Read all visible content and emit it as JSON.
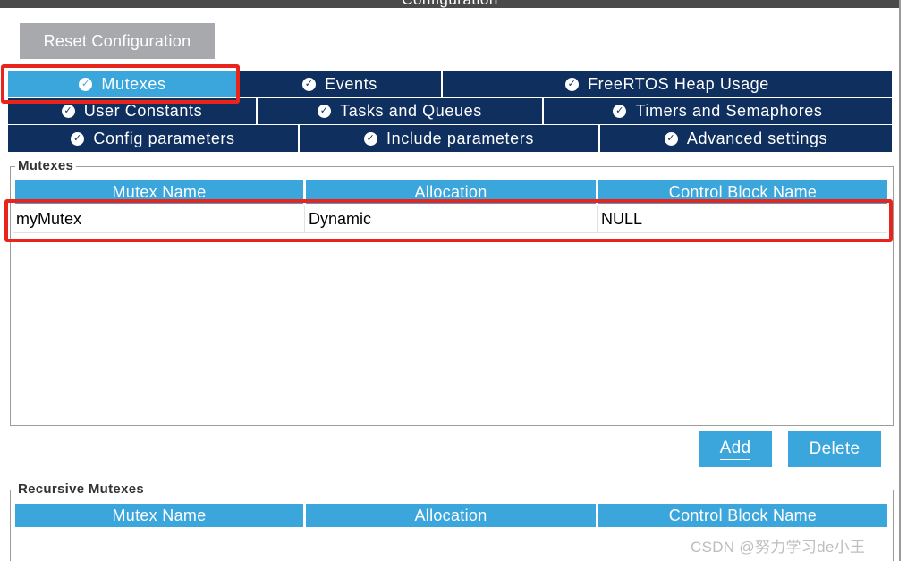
{
  "window": {
    "title": "Configuration"
  },
  "reset_button": {
    "label": "Reset Configuration"
  },
  "tabs": {
    "row1": [
      {
        "label": "Mutexes",
        "active": true
      },
      {
        "label": "Events",
        "active": false
      },
      {
        "label": "FreeRTOS Heap Usage",
        "active": false
      }
    ],
    "row2": [
      {
        "label": "User Constants",
        "active": false
      },
      {
        "label": "Tasks and Queues",
        "active": false
      },
      {
        "label": "Timers and Semaphores",
        "active": false
      }
    ],
    "row3": [
      {
        "label": "Config parameters",
        "active": false
      },
      {
        "label": "Include parameters",
        "active": false
      },
      {
        "label": "Advanced settings",
        "active": false
      }
    ],
    "check_icon": "check-circle-icon"
  },
  "mutexes": {
    "legend": "Mutexes",
    "columns": [
      "Mutex Name",
      "Allocation",
      "Control Block Name"
    ],
    "rows": [
      {
        "name": "myMutex",
        "allocation": "Dynamic",
        "control_block": "NULL"
      }
    ],
    "add_label": "Add",
    "delete_label": "Delete"
  },
  "recursive_mutexes": {
    "legend": "Recursive Mutexes",
    "columns": [
      "Mutex Name",
      "Allocation",
      "Control Block Name"
    ]
  },
  "watermark": "CSDN @努力学习de小王",
  "colors": {
    "tab_dark": "#0f2f5f",
    "tab_active": "#3aa6dc",
    "header_blue": "#3aa6dc",
    "highlight_red": "#e8241b",
    "reset_gray": "#a7a9ac"
  }
}
